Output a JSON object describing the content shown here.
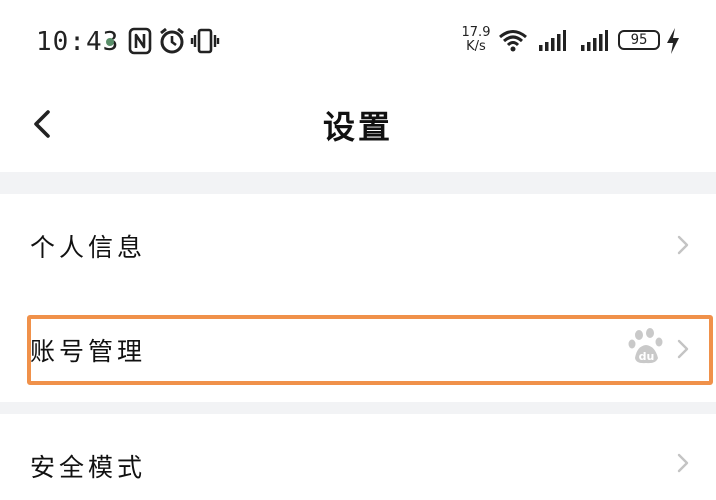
{
  "status_bar": {
    "time": "10:43",
    "net_speed_value": "17.9",
    "net_speed_unit": "K/s",
    "battery": "95",
    "icons": [
      "nfc-icon",
      "alarm-icon",
      "vibrate-icon",
      "wifi-icon",
      "signal-icon",
      "signal-icon",
      "charging-icon"
    ]
  },
  "header": {
    "title": "设置",
    "back_icon": "chevron-left-icon"
  },
  "settings": {
    "items": [
      {
        "label": "个人信息"
      },
      {
        "label": "账号管理",
        "badge_icon": "baidu-du-icon",
        "highlighted": true
      },
      {
        "label": "安全模式"
      }
    ]
  },
  "colors": {
    "highlight": "#f0914a",
    "section_gap": "#f2f3f5",
    "chevron": "#c4c4c4"
  }
}
